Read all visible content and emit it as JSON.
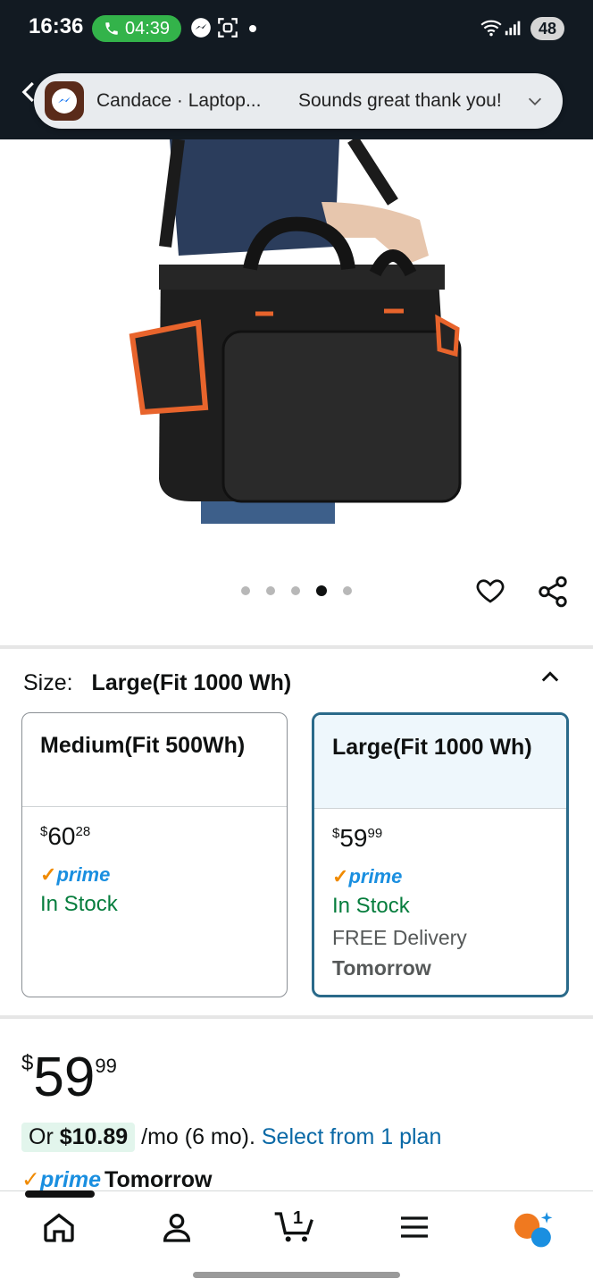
{
  "status_bar": {
    "time": "16:36",
    "call_duration": "04:39",
    "battery": "48"
  },
  "notification": {
    "app_icon": "messenger-icon",
    "title": "Candace · Laptop...",
    "message": "Sounds great thank you!"
  },
  "product": {
    "image_alt": "black-tool-bag-image",
    "carousel_count": 5,
    "carousel_active_index": 3
  },
  "size": {
    "label": "Size:",
    "selected": "Large(Fit 1000 Wh)",
    "options": [
      {
        "title": "Medium(Fit 500Wh)",
        "currency": "$",
        "price_whole": "60",
        "price_fraction": "28",
        "prime": "prime",
        "stock": "In Stock"
      },
      {
        "title": "Large(Fit 1000 Wh)",
        "currency": "$",
        "price_whole": "59",
        "price_fraction": "99",
        "prime": "prime",
        "stock": "In Stock",
        "delivery_line1": "FREE Delivery",
        "delivery_line2": "Tomorrow"
      }
    ]
  },
  "price": {
    "currency": "$",
    "whole": "59",
    "fraction": "99"
  },
  "plan": {
    "prefix": "Or ",
    "amount": "$10.89",
    "suffix": " /mo (6 mo). ",
    "link": "Select from 1 plan"
  },
  "delivery": {
    "prime": "prime",
    "text": "Tomorrow"
  },
  "bottom_nav": {
    "cart_count": "1"
  },
  "colors": {
    "status_bg": "#121a22",
    "selected_border": "#2a6a8a",
    "stock_green": "#067d3d",
    "link_blue": "#0a69a6",
    "prime_blue": "#1a8fe0"
  }
}
